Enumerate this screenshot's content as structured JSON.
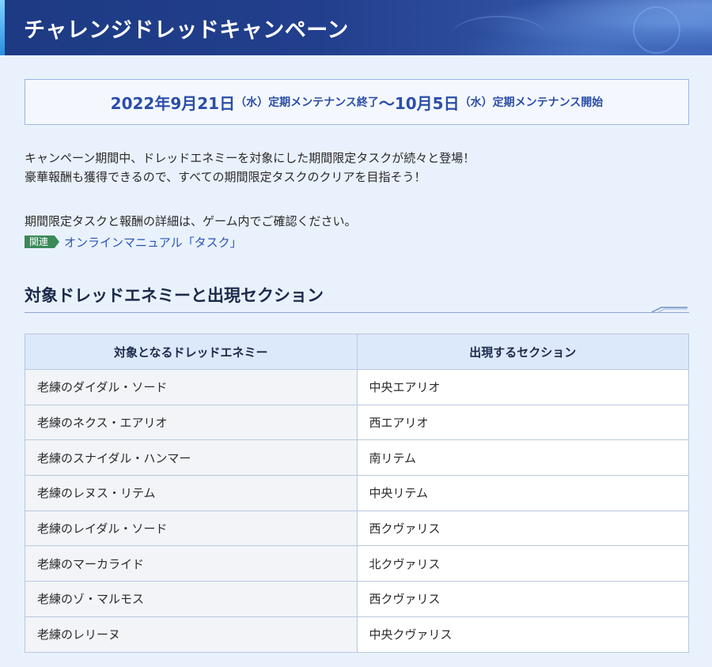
{
  "header": {
    "title": "チャレンジドレッドキャンペーン"
  },
  "period": {
    "start_date": "2022年9月21日",
    "start_day": "（水）",
    "start_event": "定期メンテナンス終了",
    "tilde": "～",
    "end_date": "10月5日",
    "end_day": "（水）",
    "end_event": "定期メンテナンス開始"
  },
  "intro": {
    "line1": "キャンペーン期間中、ドレッドエネミーを対象にした期間限定タスクが続々と登場！",
    "line2": "豪華報酬も獲得できるので、すべての期間限定タスクのクリアを目指そう！",
    "line3": "期間限定タスクと報酬の詳細は、ゲーム内でご確認ください。"
  },
  "related": {
    "tag": "関連",
    "link": "オンラインマニュアル「タスク」"
  },
  "section": {
    "title": "対象ドレッドエネミーと出現セクション"
  },
  "table": {
    "headers": [
      "対象となるドレッドエネミー",
      "出現するセクション"
    ],
    "rows": [
      [
        "老練のダイダル・ソード",
        "中央エアリオ"
      ],
      [
        "老練のネクス・エアリオ",
        "西エアリオ"
      ],
      [
        "老練のスナイダル・ハンマー",
        "南リテム"
      ],
      [
        "老練のレヌス・リテム",
        "中央リテム"
      ],
      [
        "老練のレイダル・ソード",
        "西クヴァリス"
      ],
      [
        "老練のマーカライド",
        "北クヴァリス"
      ],
      [
        "老練のゾ・マルモス",
        "西クヴァリス"
      ],
      [
        "老練のレリーヌ",
        "中央クヴァリス"
      ]
    ]
  },
  "colors": {
    "header_bg": "#223f8d",
    "accent_blue": "#2b4ea8",
    "tag_green": "#3a8a58",
    "link_blue": "#2a54b8",
    "page_bg": "#e9f1fc"
  }
}
